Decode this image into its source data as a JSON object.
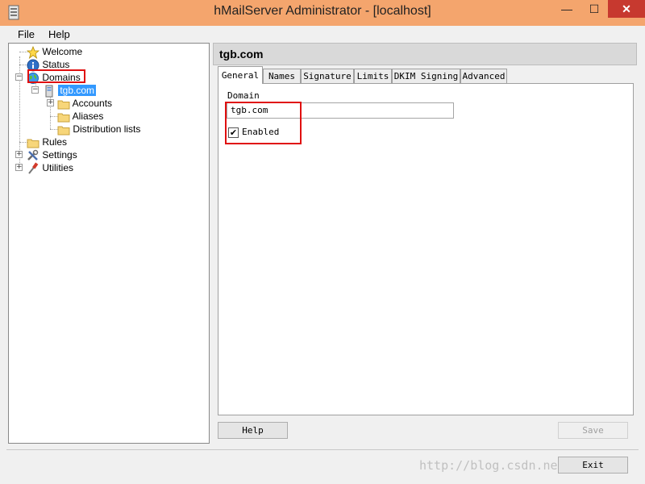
{
  "window": {
    "title": "hMailServer Administrator - [localhost]",
    "controls": {
      "minimize": "—",
      "maximize": "☐",
      "close": "✕"
    },
    "title_bar_color": "#f4a56d",
    "close_color": "#c7392f"
  },
  "menu": {
    "items": [
      "File",
      "Help"
    ]
  },
  "tree": {
    "items": [
      {
        "label": "Welcome",
        "icon": "star-icon"
      },
      {
        "label": "Status",
        "icon": "info-icon"
      },
      {
        "label": "Domains",
        "icon": "globe-icon",
        "expanded": true
      },
      {
        "label": "tgb.com",
        "icon": "server-icon",
        "selected": true,
        "expanded": true
      },
      {
        "label": "Accounts",
        "icon": "folder-icon"
      },
      {
        "label": "Aliases",
        "icon": "folder-icon"
      },
      {
        "label": "Distribution lists",
        "icon": "folder-icon"
      },
      {
        "label": "Rules",
        "icon": "folder-icon"
      },
      {
        "label": "Settings",
        "icon": "tools-icon"
      },
      {
        "label": "Utilities",
        "icon": "utilities-icon"
      }
    ],
    "selection_color": "#3399ff"
  },
  "panel": {
    "title": "tgb.com",
    "tabs": [
      "General",
      "Names",
      "Signature",
      "Limits",
      "DKIM Signing",
      "Advanced"
    ],
    "active_tab": "General",
    "general": {
      "domain_label": "Domain",
      "domain_value": "tgb.com",
      "enabled_label": "Enabled",
      "enabled_checked": true,
      "check_mark": "✔"
    }
  },
  "buttons": {
    "help": "Help",
    "save": "Save",
    "exit": "Exit"
  },
  "watermark": "http://blog.csdn.net/liupu",
  "annotation_color": "#e01010"
}
